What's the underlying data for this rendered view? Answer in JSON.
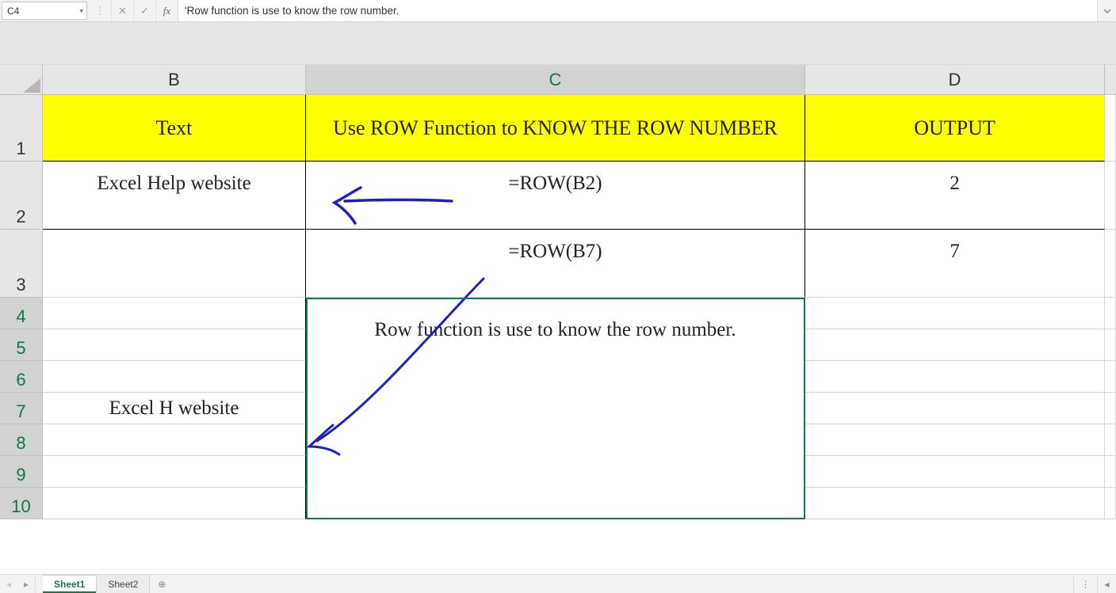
{
  "formula_bar": {
    "cell_ref": "C4",
    "formula_text": "'Row function is use to know the row number."
  },
  "columns": {
    "B": "B",
    "C": "C",
    "D": "D"
  },
  "rows": [
    "1",
    "2",
    "3",
    "4",
    "5",
    "6",
    "7",
    "8",
    "9",
    "10"
  ],
  "headers": {
    "text": "Text",
    "c": "Use ROW Function to KNOW THE ROW NUMBER",
    "output": "OUTPUT"
  },
  "data": {
    "b2": "Excel Help website",
    "c2": "=ROW(B2)",
    "d2": "2",
    "c3": "=ROW(B7)",
    "d3": "7",
    "b7": "Excel H website",
    "note": "Row function is use to know the row number."
  },
  "tabs": {
    "sheet1": "Sheet1",
    "sheet2": "Sheet2"
  },
  "icons": {
    "cancel": "✕",
    "accept": "✓",
    "fx": "fx",
    "drop": "▾",
    "sep_dots": "⋮",
    "plus": "⊕",
    "tri_left": "◂",
    "tri_right": "▸"
  }
}
